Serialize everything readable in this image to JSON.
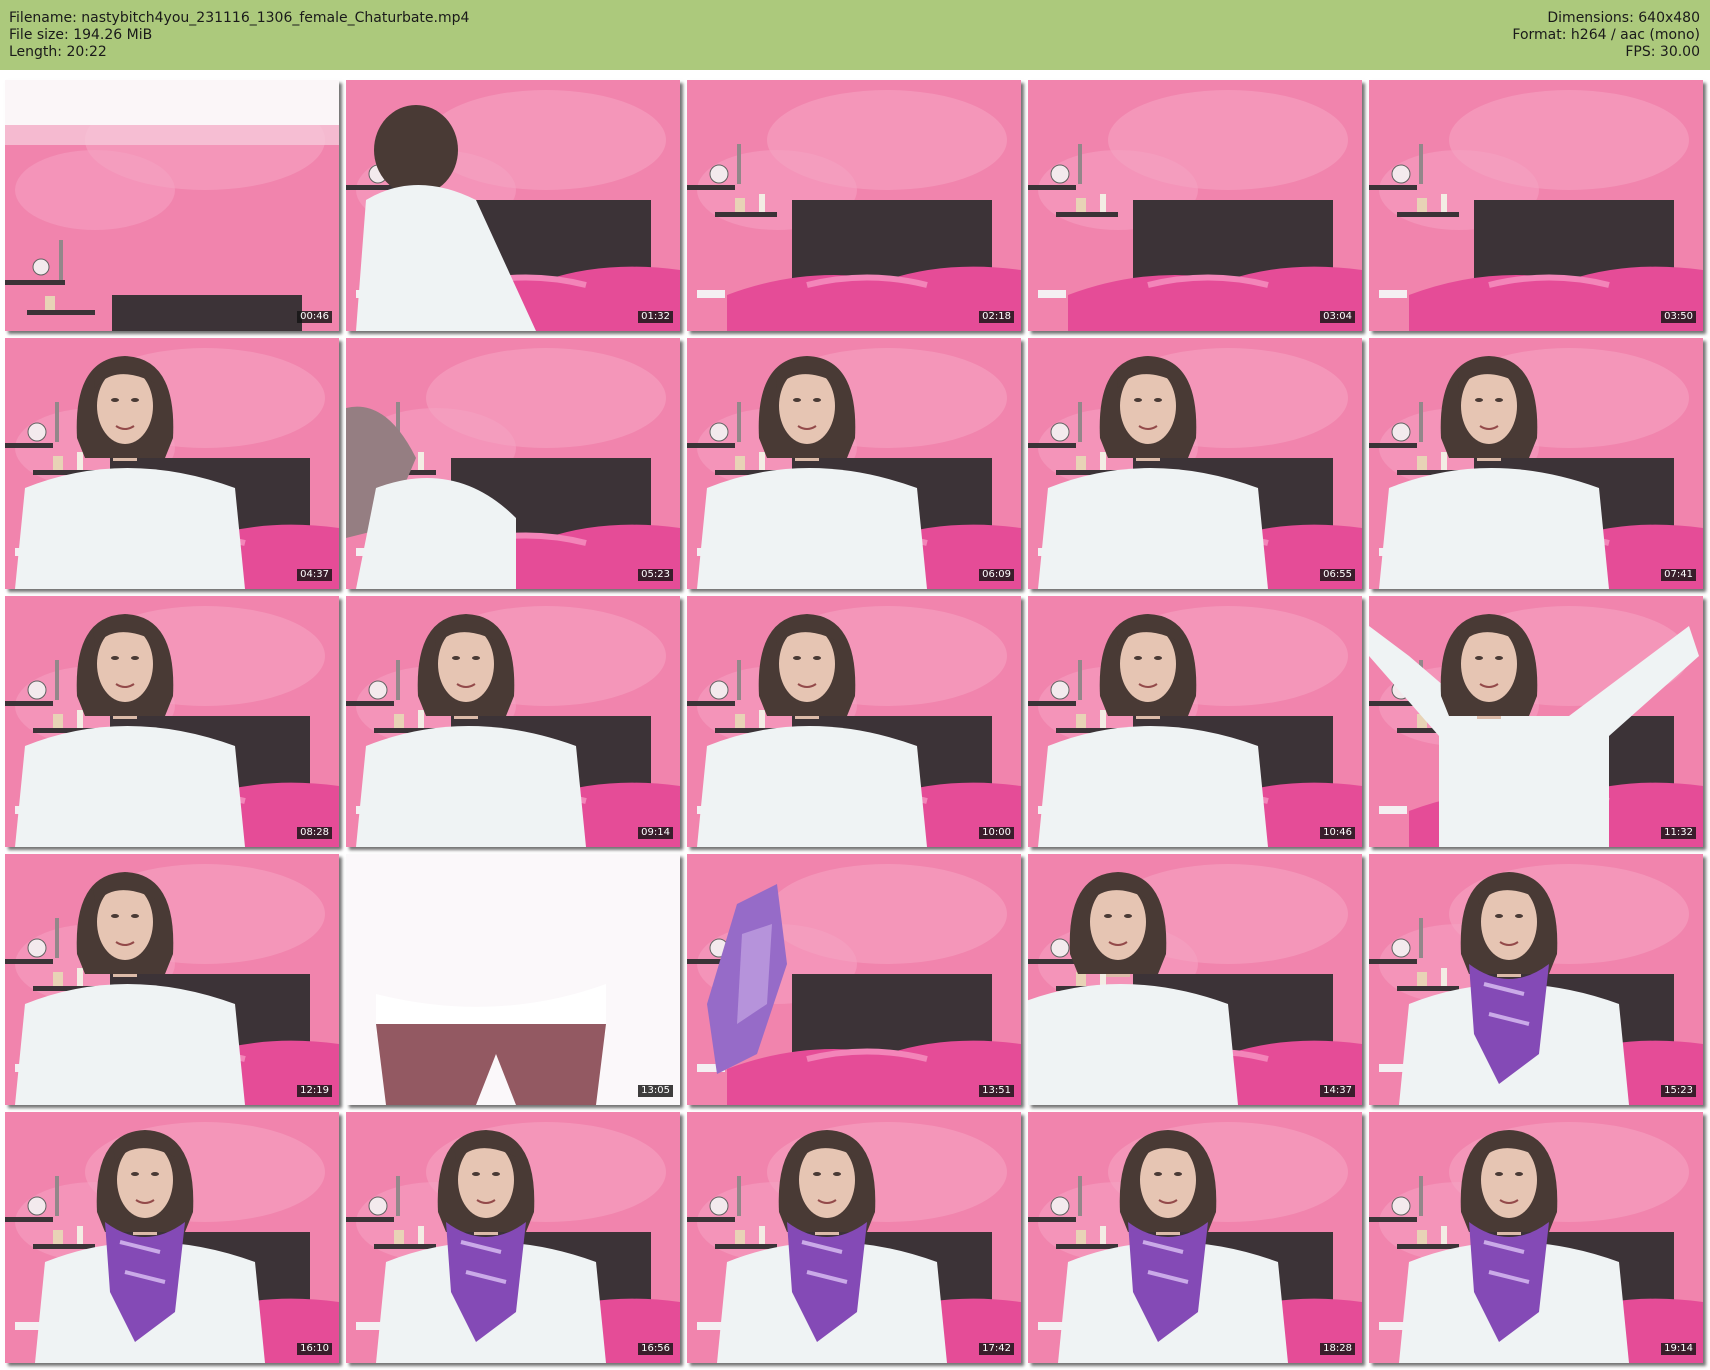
{
  "header": {
    "filename": "Filename: nastybitch4you_231116_1306_female_Chaturbate.mp4",
    "filesize": "File size: 194.26 MiB",
    "length": "Length: 20:22",
    "dimensions": "Dimensions: 640x480",
    "format": "Format: h264 / aac (mono)",
    "fps": "FPS: 30.00"
  },
  "colors": {
    "header_bg": "#acc97c",
    "wall": "#f07aa6",
    "bed": "#e33d8f",
    "headboard": "#2c2226",
    "sweater": "#eef2f4",
    "hair": "#3a2a24",
    "scarf": "#7a3bb0"
  },
  "thumbnails": [
    {
      "time": "00:46",
      "scene": "empty-room-high"
    },
    {
      "time": "01:32",
      "scene": "back-turned"
    },
    {
      "time": "02:18",
      "scene": "empty-room"
    },
    {
      "time": "03:04",
      "scene": "empty-room"
    },
    {
      "time": "03:50",
      "scene": "empty-room"
    },
    {
      "time": "04:37",
      "scene": "person"
    },
    {
      "time": "05:23",
      "scene": "close-motion"
    },
    {
      "time": "06:09",
      "scene": "person"
    },
    {
      "time": "06:55",
      "scene": "person"
    },
    {
      "time": "07:41",
      "scene": "person"
    },
    {
      "time": "08:28",
      "scene": "person"
    },
    {
      "time": "09:14",
      "scene": "person"
    },
    {
      "time": "10:00",
      "scene": "person"
    },
    {
      "time": "10:46",
      "scene": "person"
    },
    {
      "time": "11:32",
      "scene": "arms-up"
    },
    {
      "time": "12:19",
      "scene": "person"
    },
    {
      "time": "13:05",
      "scene": "close-body"
    },
    {
      "time": "13:51",
      "scene": "fabric"
    },
    {
      "time": "14:37",
      "scene": "person-laugh"
    },
    {
      "time": "15:23",
      "scene": "person-scarf"
    },
    {
      "time": "16:10",
      "scene": "person-scarf"
    },
    {
      "time": "16:56",
      "scene": "person-scarf"
    },
    {
      "time": "17:42",
      "scene": "person-scarf"
    },
    {
      "time": "18:28",
      "scene": "person-scarf"
    },
    {
      "time": "19:14",
      "scene": "person-scarf"
    }
  ]
}
